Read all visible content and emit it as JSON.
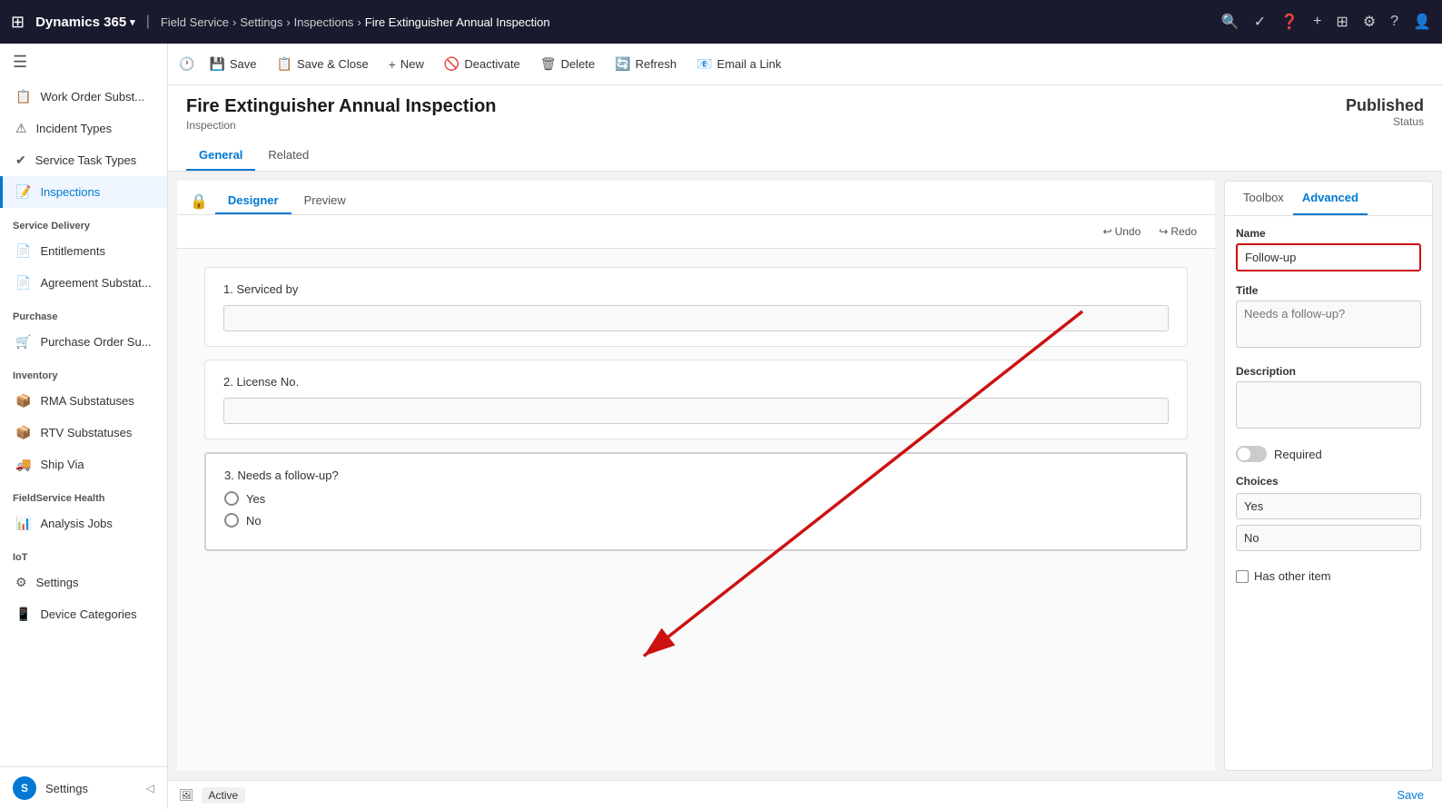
{
  "topnav": {
    "grid_icon": "⊞",
    "brand": "Dynamics 365",
    "caret": "▾",
    "app_name": "Field Service",
    "breadcrumb": [
      "Settings",
      "Inspections",
      "Fire Extinguisher Annual Inspection"
    ],
    "icons": [
      "🔍",
      "✓",
      "❓",
      "+",
      "⊞",
      "⚙",
      "?",
      "👤"
    ]
  },
  "sidebar": {
    "toggle_icon": "☰",
    "items": [
      {
        "id": "work-order-subst",
        "label": "Work Order Subst...",
        "icon": "📋"
      },
      {
        "id": "incident-types",
        "label": "Incident Types",
        "icon": "⚠"
      },
      {
        "id": "service-task-types",
        "label": "Service Task Types",
        "icon": "✔"
      },
      {
        "id": "inspections",
        "label": "Inspections",
        "icon": "📝",
        "active": true
      }
    ],
    "sections": [
      {
        "header": "Service Delivery",
        "items": [
          {
            "id": "entitlements",
            "label": "Entitlements",
            "icon": "📄"
          },
          {
            "id": "agreement-substat",
            "label": "Agreement Substat...",
            "icon": "📄"
          }
        ]
      },
      {
        "header": "Purchase",
        "items": [
          {
            "id": "purchase-order-su",
            "label": "Purchase Order Su...",
            "icon": "🛒"
          }
        ]
      },
      {
        "header": "Inventory",
        "items": [
          {
            "id": "rma-substatuses",
            "label": "RMA Substatuses",
            "icon": "📦"
          },
          {
            "id": "rtv-substatuses",
            "label": "RTV Substatuses",
            "icon": "📦"
          },
          {
            "id": "ship-via",
            "label": "Ship Via",
            "icon": "🚚"
          }
        ]
      },
      {
        "header": "FieldService Health",
        "items": [
          {
            "id": "analysis-jobs",
            "label": "Analysis Jobs",
            "icon": "📊"
          }
        ]
      },
      {
        "header": "IoT",
        "items": [
          {
            "id": "settings",
            "label": "Settings",
            "icon": "⚙"
          },
          {
            "id": "device-categories",
            "label": "Device Categories",
            "icon": "📱"
          }
        ]
      }
    ],
    "bottom_user": "S",
    "bottom_label": "Settings",
    "bottom_icon": "◁"
  },
  "toolbar": {
    "save_label": "Save",
    "save_close_label": "Save & Close",
    "new_label": "New",
    "deactivate_label": "Deactivate",
    "delete_label": "Delete",
    "refresh_label": "Refresh",
    "email_link_label": "Email a Link",
    "undo_label": "Undo",
    "redo_label": "Redo"
  },
  "form": {
    "title": "Fire Extinguisher Annual Inspection",
    "subtitle": "Inspection",
    "status": "Published",
    "status_sub": "Status",
    "tabs": [
      "General",
      "Related"
    ],
    "active_tab": "General",
    "subtabs": [
      "Designer",
      "Preview"
    ],
    "active_subtab": "Designer"
  },
  "questions": [
    {
      "id": "q1",
      "number": "1.",
      "label": "Serviced by",
      "type": "text"
    },
    {
      "id": "q2",
      "number": "2.",
      "label": "License No.",
      "type": "text"
    },
    {
      "id": "q3",
      "number": "3.",
      "label": "Needs a follow-up?",
      "type": "radio",
      "options": [
        "Yes",
        "No"
      ]
    }
  ],
  "right_panel": {
    "tabs": [
      "Toolbox",
      "Advanced"
    ],
    "active_tab": "Advanced",
    "name_label": "Name",
    "name_value": "Follow-up",
    "title_label": "Title",
    "title_placeholder": "Needs a follow-up?",
    "description_label": "Description",
    "description_value": "",
    "required_label": "Required",
    "choices_label": "Choices",
    "choice_yes": "Yes",
    "choice_no": "No",
    "has_other_label": "Has other item"
  },
  "status_bar": {
    "icon": "🖼",
    "status": "Active",
    "save_label": "Save"
  }
}
